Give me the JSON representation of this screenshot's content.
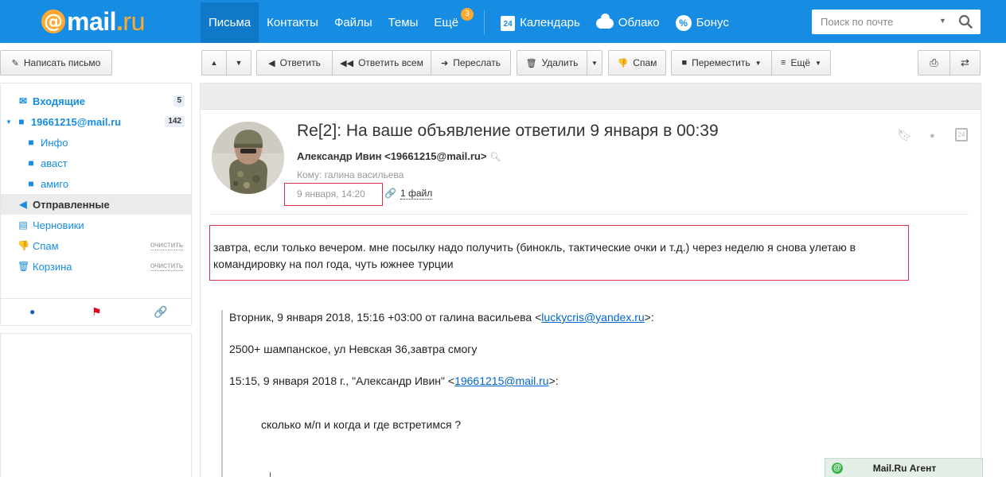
{
  "logo": {
    "at": "@",
    "name": "mail",
    "dot": ".",
    "tld": "ru"
  },
  "nav": {
    "items": [
      "Письма",
      "Контакты",
      "Файлы",
      "Темы",
      "Ещё"
    ],
    "more_badge": "3",
    "calendar": "Календарь",
    "calendar_day": "24",
    "cloud": "Облако",
    "bonus": "Бонус"
  },
  "search": {
    "placeholder": "Поиск по почте"
  },
  "toolbar": {
    "compose": "Написать письмо",
    "reply": "Ответить",
    "reply_all": "Ответить всем",
    "forward": "Переслать",
    "delete": "Удалить",
    "spam": "Спам",
    "move": "Переместить",
    "more": "Ещё"
  },
  "sidebar": {
    "inbox": {
      "label": "Входящие",
      "count": "5"
    },
    "account": {
      "label": "19661215@mail.ru",
      "count": "142"
    },
    "subfolders": [
      "Инфо",
      "аваст",
      "амиго"
    ],
    "sent": "Отправленные",
    "drafts": "Черновики",
    "spam": {
      "label": "Спам",
      "action": "очистить"
    },
    "trash": {
      "label": "Корзина",
      "action": "очистить"
    }
  },
  "message": {
    "subject": "Re[2]: На ваше объявление ответили 9 января в 00:39",
    "sender": "Александр Ивин <19661215@mail.ru>",
    "to": "Кому: галина васильева",
    "date": "9 января, 14:20",
    "attachment": "1 файл",
    "header_calendar_day": "24",
    "body": "завтра, если только вечером. мне посылку надо получить (бинокль, тактические очки и т.д.) через неделю я снова улетаю в командировку на пол года, чуть южнее турции",
    "quote": {
      "line1_prefix": "Вторник, 9 января 2018, 15:16 +03:00 от галина васильева <",
      "line1_email": "luckycris@yandex.ru",
      "line1_suffix": ">:",
      "line2": "2500+ шампанское, ул Невская 36,завтра смогу",
      "line3_prefix": "15:15, 9 января 2018 г., \"Александр Ивин\" <",
      "line3_email": "19661215@mail.ru",
      "line3_suffix": ">:",
      "line4": "сколько м/п и когда и где встретимся ?"
    }
  },
  "agent": {
    "label": "Mail.Ru Агент",
    "icon": "@"
  },
  "colors": {
    "brand": "#168de2",
    "accent": "#ffa930",
    "highlight": "#d9324a",
    "link": "#0066cc"
  }
}
